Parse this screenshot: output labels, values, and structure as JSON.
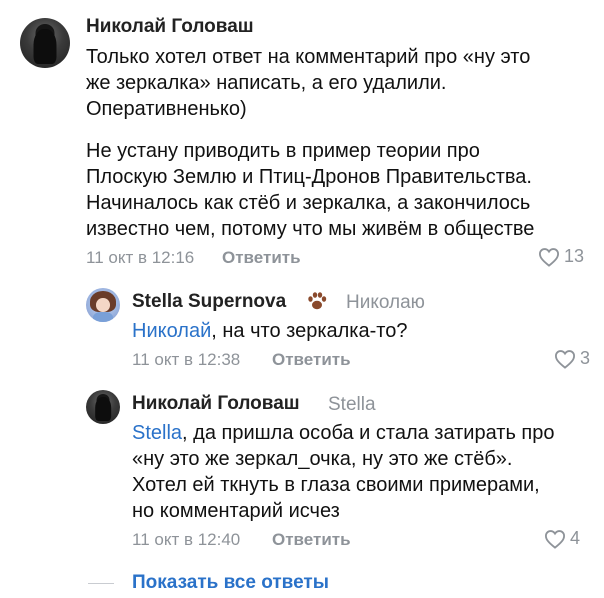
{
  "comments": [
    {
      "author": "Николай Головаш",
      "paragraphs": [
        "Только хотел ответ на комментарий про «ну это",
        "же зеркалка» написать, а его удалили.",
        "Оперативненько)"
      ],
      "paragraphs2": [
        "Не устану приводить в пример теории про",
        "Плоскую Землю и Птиц-Дронов Правительства.",
        "Начиналось как стёб и зеркалка, а закончилось",
        "известно чем, потому что мы живём в обществе"
      ],
      "time": "11 окт в 12:16",
      "reply_label": "Ответить",
      "likes": "13"
    },
    {
      "author": "Stella Supernova",
      "reply_to": "Николаю",
      "mention": "Николай",
      "text": ", на что зеркалка-то?",
      "time": "11 окт в 12:38",
      "reply_label": "Ответить",
      "likes": "3"
    },
    {
      "author": "Николай Головаш",
      "reply_to": "Stella",
      "mention": "Stella",
      "line1_rest": ", да пришла особа и стала затирать про",
      "lines": [
        "«ну это же зеркал_очка, ну это же стёб».",
        "Хотел ей ткнуть в глаза своими примерами,",
        "но комментарий исчез"
      ],
      "time": "11 окт в 12:40",
      "reply_label": "Ответить",
      "likes": "4"
    }
  ],
  "show_all_label": "Показать все ответы",
  "colors": {
    "link": "#2a72c9",
    "meta": "#8e9399",
    "text": "#111111"
  }
}
